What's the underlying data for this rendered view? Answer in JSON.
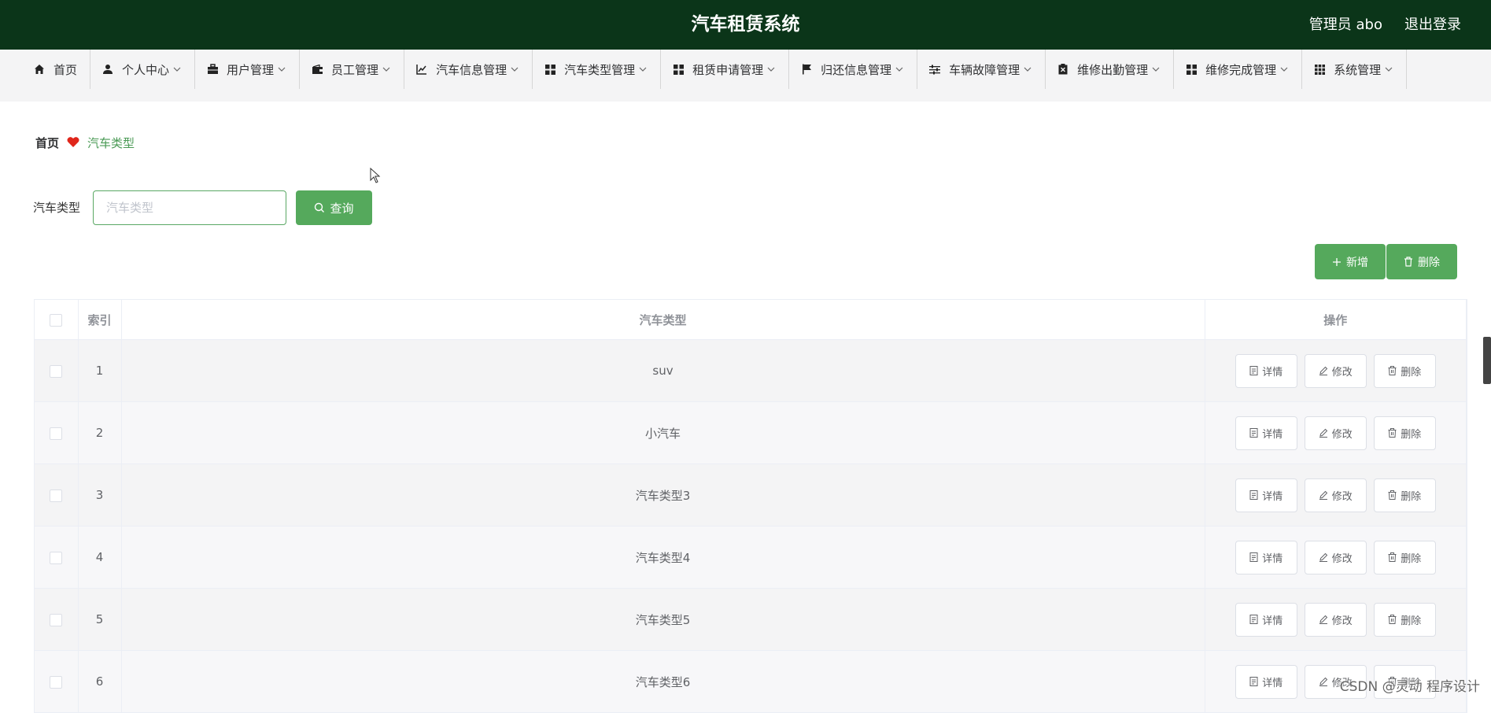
{
  "header": {
    "title": "汽车租赁系统",
    "admin_label": "管理员 abo",
    "logout_label": "退出登录",
    "bg_color": "#0b3519"
  },
  "nav": {
    "items": [
      {
        "label": "首页",
        "icon": "home-icon"
      },
      {
        "label": "个人中心",
        "icon": "user-icon"
      },
      {
        "label": "用户管理",
        "icon": "briefcase-icon"
      },
      {
        "label": "员工管理",
        "icon": "wallet-icon"
      },
      {
        "label": "汽车信息管理",
        "icon": "chart-line-icon"
      },
      {
        "label": "汽车类型管理",
        "icon": "grid-icon"
      },
      {
        "label": "租赁申请管理",
        "icon": "grid-icon"
      },
      {
        "label": "归还信息管理",
        "icon": "flag-icon"
      },
      {
        "label": "车辆故障管理",
        "icon": "sliders-icon"
      },
      {
        "label": "维修出勤管理",
        "icon": "clipboard-x-icon"
      },
      {
        "label": "维修完成管理",
        "icon": "grid-icon"
      },
      {
        "label": "系统管理",
        "icon": "grid9-icon"
      }
    ]
  },
  "breadcrumb": {
    "home": "首页",
    "current": "汽车类型"
  },
  "search": {
    "label": "汽车类型",
    "placeholder": "汽车类型",
    "value": "",
    "button_label": "查询"
  },
  "actions": {
    "add_label": "新增",
    "delete_label": "删除"
  },
  "table": {
    "headers": {
      "index": "索引",
      "type": "汽车类型",
      "ops": "操作"
    },
    "rows": [
      {
        "index": "1",
        "type": "suv"
      },
      {
        "index": "2",
        "type": "小汽车"
      },
      {
        "index": "3",
        "type": "汽车类型3"
      },
      {
        "index": "4",
        "type": "汽车类型4"
      },
      {
        "index": "5",
        "type": "汽车类型5"
      },
      {
        "index": "6",
        "type": "汽车类型6"
      }
    ],
    "row_actions": {
      "detail": "详情",
      "edit": "修改",
      "delete": "删除"
    }
  },
  "watermark": "CSDN @灵动 程序设计",
  "colors": {
    "accent": "#55a95c",
    "breadcrumb_current": "#4a9a55",
    "heart": "#e0261b"
  }
}
